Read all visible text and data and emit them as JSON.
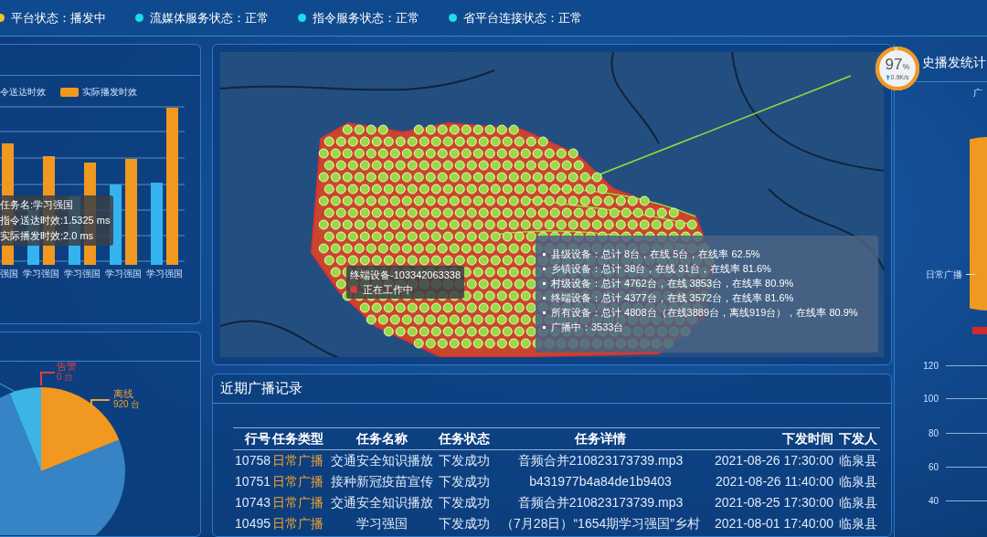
{
  "status_bar": [
    {
      "label": "平台状态：",
      "value": "播发中",
      "color": "#f2c12e"
    },
    {
      "label": "流媒体服务状态：",
      "value": "正常",
      "color": "#19e0e6"
    },
    {
      "label": "指令服务状态：",
      "value": "正常",
      "color": "#19e0e6"
    },
    {
      "label": "省平台连接状态：",
      "value": "正常",
      "color": "#19e0e6"
    }
  ],
  "timing_chart": {
    "legend": [
      {
        "label": "令送达时效",
        "color": "#35b3ee"
      },
      {
        "label": "实际播发时效",
        "color": "#f0981f"
      }
    ],
    "categories": [
      "强国",
      "学习强国",
      "学习强国",
      "学习强国",
      "学习强国"
    ],
    "tooltip": [
      "任务名:学习强国",
      "指令送达时效:1.5325 ms",
      "实际播发时效:2.0 ms"
    ]
  },
  "device_pie": {
    "labels": [
      {
        "name": "告警",
        "count": "0 台",
        "color": "#e0413a"
      },
      {
        "name": "离线",
        "count": "920 台",
        "color": "#f0a030"
      }
    ]
  },
  "map": {
    "gauge": {
      "value": "97",
      "unit": "%",
      "rate": "0.9K/s",
      "level": 0.97
    },
    "device_tooltip": {
      "device": "终端设备-103342063338",
      "status": "正在工作中"
    },
    "stats": [
      "县级设备：总计 8台，在线 5台，在线率 62.5%",
      "乡镇设备：总计 38台，在线 31台，在线率 81.6%",
      "村级设备：总计 4762台，在线 3853台，在线率 80.9%",
      "终端设备：总计 4377台，在线 3572台，在线率 81.6%",
      "所有设备：总计 4808台（在线3889台，离线919台），在线率 80.9%",
      "广播中：3533台"
    ]
  },
  "records": {
    "title": "近期广播记录",
    "columns": [
      "行号",
      "任务类型",
      "任务名称",
      "任务状态",
      "任务详情",
      "下发时间",
      "下发人"
    ],
    "rows": [
      [
        "10758",
        "日常广播",
        "交通安全知识播放",
        "下发成功",
        "音频合并210823173739.mp3",
        "2021-08-26 17:30:00",
        "临泉县"
      ],
      [
        "10751",
        "日常广播",
        "接种新冠疫苗宣传",
        "下发成功",
        "b431977b4a84de1b9403",
        "2021-08-26 11:40:00",
        "临泉县"
      ],
      [
        "10743",
        "日常广播",
        "交通安全知识播放",
        "下发成功",
        "音频合并210823173739.mp3",
        "2021-08-25 17:30:00",
        "临泉县"
      ],
      [
        "10495",
        "日常广播",
        "学习强国",
        "下发成功",
        "（7月28日）“1654期学习强国”乡村",
        "2021-08-01 17:40:00",
        "临泉县"
      ]
    ]
  },
  "history": {
    "title": "史播发统计",
    "pie_labels": [
      "广",
      "日常广播"
    ],
    "axis_ticks": [
      "120",
      "100",
      "80",
      "60",
      "40"
    ]
  }
}
